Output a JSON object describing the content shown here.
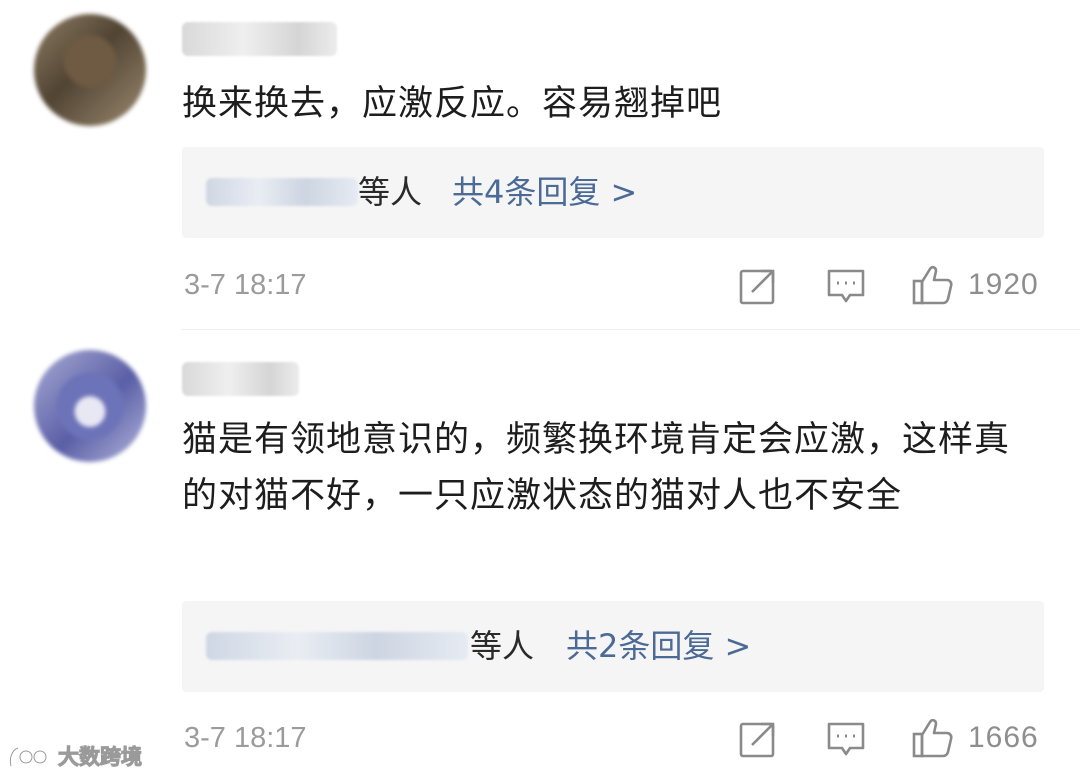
{
  "comments": [
    {
      "text": "换来换去，应激反应。容易翘掉吧",
      "reply_people_suffix": "等人",
      "reply_total": "共4条回复 >",
      "time": "3-7 18:17",
      "likes": "1920"
    },
    {
      "text": "猫是有领地意识的，频繁换环境肯定会应激，这样真的对猫不好，一只应激状态的猫对人也不安全",
      "reply_people_suffix": "等人",
      "reply_total": "共2条回复 >",
      "time": "3-7 18:17",
      "likes": "1666"
    }
  ],
  "icons": {
    "share": "share-icon",
    "comment": "comment-icon",
    "like": "thumbs-up-icon"
  },
  "colors": {
    "reply_link": "#4c6a96",
    "meta_gray": "#9b9b9b",
    "reply_bg": "#f5f5f5"
  },
  "watermark": {
    "text": "大数跨境"
  }
}
